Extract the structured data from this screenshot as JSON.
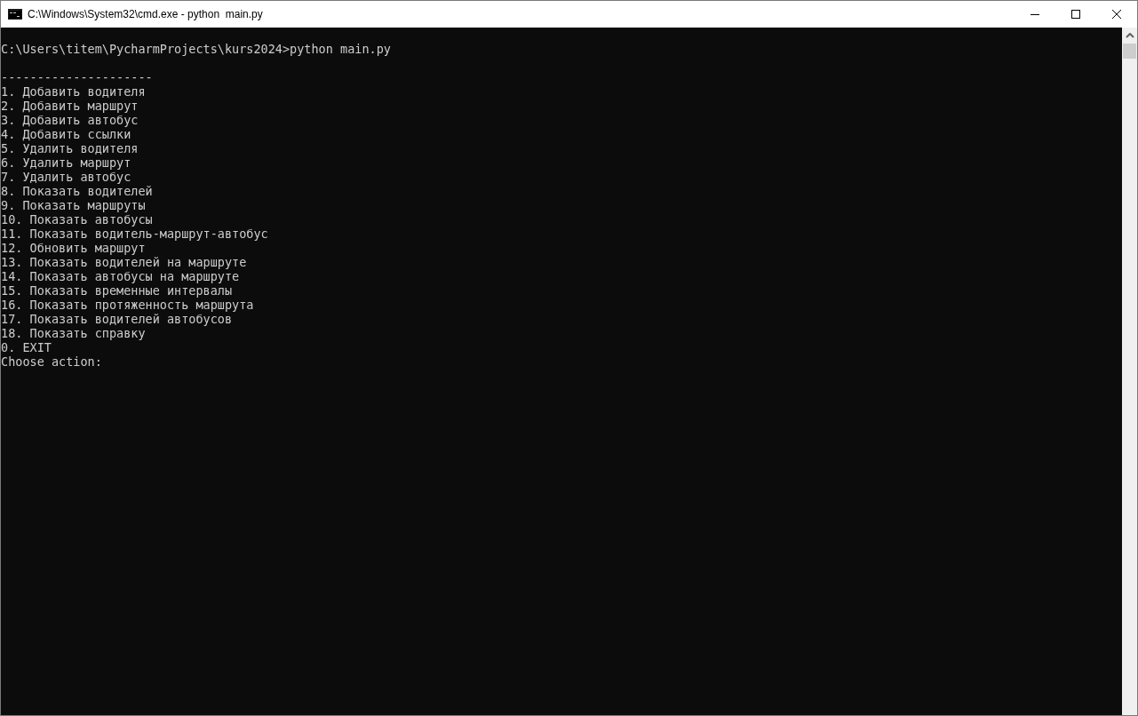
{
  "window": {
    "title": "C:\\Windows\\System32\\cmd.exe - python  main.py"
  },
  "console": {
    "command_line": "C:\\Users\\titem\\PycharmProjects\\kurs2024>python main.py",
    "output_lines": [
      "---------------------",
      "1. Добавить водителя",
      "2. Добавить маршрут",
      "3. Добавить автобус",
      "4. Добавить ссылки",
      "5. Удалить водителя",
      "6. Удалить маршрут",
      "7. Удалить автобус",
      "8. Показать водителей",
      "9. Показать маршруты",
      "10. Показать автобусы",
      "11. Показать водитель-маршрут-автобус",
      "12. Обновить маршрут",
      "13. Показать водителей на маршруте",
      "14. Показать автобусы на маршруте",
      "15. Показать временные интервалы",
      "16. Показать протяженность маршрута",
      "17. Показать водителей автобусов",
      "18. Показать справку",
      "0. EXIT",
      "Choose action:"
    ]
  }
}
